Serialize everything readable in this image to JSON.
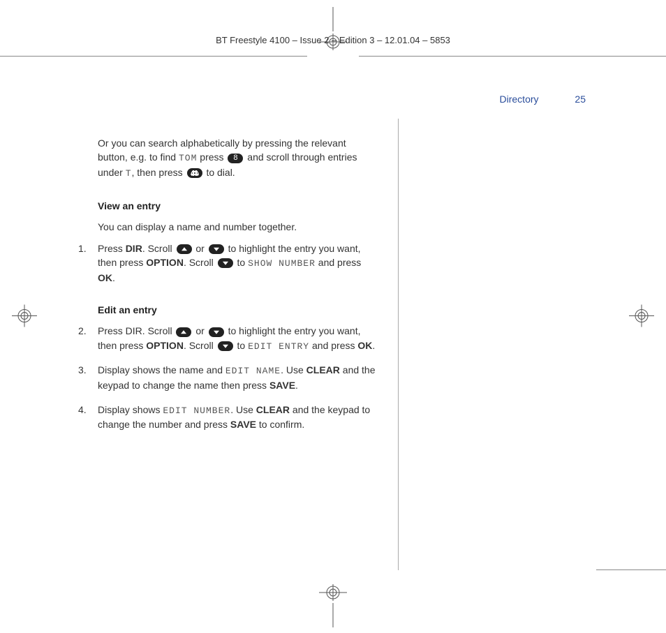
{
  "header": "BT Freestyle 4100 – Issue 2 – Edition 3 – 12.01.04 – 5853",
  "runhead": {
    "section": "Directory",
    "page": "25"
  },
  "intro": {
    "t1a": "Or you can search alphabetically by pressing the relevant button, e.g. to find ",
    "disp_tom": "TOM",
    "t1b": " press ",
    "t1c": " and scroll through entries under ",
    "disp_t": "T",
    "t1d": ", then press ",
    "t1e": " to dial."
  },
  "view_heading": "View an entry",
  "view_sub": "You can display a name and number together.",
  "step1": {
    "num": "1.",
    "a": "Press ",
    "dir": "DIR",
    "b": ". Scroll ",
    "or": " or ",
    "c": " to highlight the entry you want, then press ",
    "option": "OPTION",
    "d": ". Scroll ",
    "e": " to ",
    "disp": "SHOW NUMBER",
    "f": " and press ",
    "ok": "OK",
    "g": "."
  },
  "edit_heading": "Edit an entry",
  "step2": {
    "num": "2.",
    "a": "Press DIR. Scroll ",
    "or": " or ",
    "b": " to highlight the entry you want, then press ",
    "option": "OPTION",
    "c": ". Scroll ",
    "d": " to ",
    "disp": "EDIT ENTRY",
    "e": " and press ",
    "ok": "OK",
    "f": "."
  },
  "step3": {
    "num": "3.",
    "a": "Display shows the name and ",
    "disp": "EDIT NAME",
    "b": ". Use ",
    "clear": "CLEAR",
    "c": " and the keypad to change the name then press ",
    "save": "SAVE",
    "d": "."
  },
  "step4": {
    "num": "4.",
    "a": "Display shows ",
    "disp": "EDIT NUMBER",
    "b": ". Use ",
    "clear": "CLEAR",
    "c": " and the keypad to change the number and press ",
    "save": "SAVE",
    "d": " to confirm."
  }
}
